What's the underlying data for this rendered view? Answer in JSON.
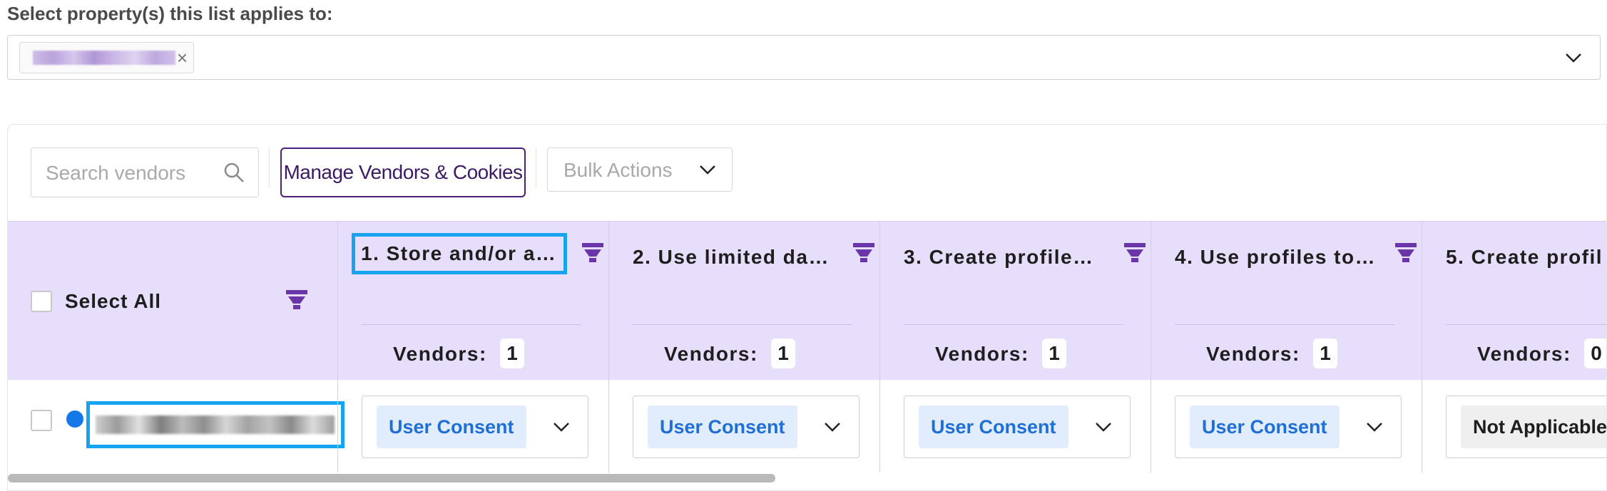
{
  "property_selector": {
    "label": "Select property(s) this list applies to:",
    "selected_tag_close": "×"
  },
  "toolbar": {
    "search_placeholder": "Search vendors",
    "manage_label": "Manage Vendors & Cookies",
    "bulk_label": "Bulk Actions"
  },
  "table": {
    "select_all_label": "Select All",
    "vendors_label": "Vendors:",
    "columns": [
      {
        "title": "1. Store and/or a…",
        "vendors": "1",
        "cell": "User Consent"
      },
      {
        "title": "2. Use limited da…",
        "vendors": "1",
        "cell": "User Consent"
      },
      {
        "title": "3. Create profile…",
        "vendors": "1",
        "cell": "User Consent"
      },
      {
        "title": "4. Use profiles to…",
        "vendors": "1",
        "cell": "User Consent"
      },
      {
        "title": "5. Create profil",
        "vendors": "0",
        "cell": "Not Applicable"
      }
    ]
  },
  "colors": {
    "header_bg": "#e6defa",
    "accent_purple": "#4a2079",
    "highlight_blue": "#16a3ef",
    "consent_blue": "#1f6fd6",
    "status_dot": "#1478e8"
  },
  "icons": {
    "search": "search-icon",
    "filter": "funnel-icon",
    "chevron": "chevron-down-icon",
    "close": "close-icon"
  }
}
